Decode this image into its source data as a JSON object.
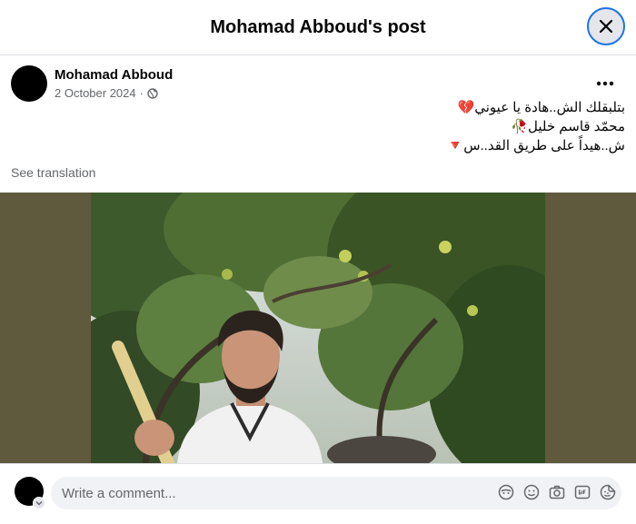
{
  "header": {
    "title": "Mohamad Abboud's post"
  },
  "post": {
    "author": "Mohamad Abboud",
    "date": "2 October 2024",
    "separator": "·",
    "text_lines": [
      "بتلبقلك الش..هادة يا عيوني💔",
      "محمّد قاسم خليل🥀",
      "ش..هيداً على طريق القد..س🔻"
    ],
    "see_translation": "See translation"
  },
  "comment": {
    "placeholder": "Write a comment..."
  },
  "colors": {
    "accent": "#1b74e4",
    "media_bg": "#5f5a3d"
  }
}
